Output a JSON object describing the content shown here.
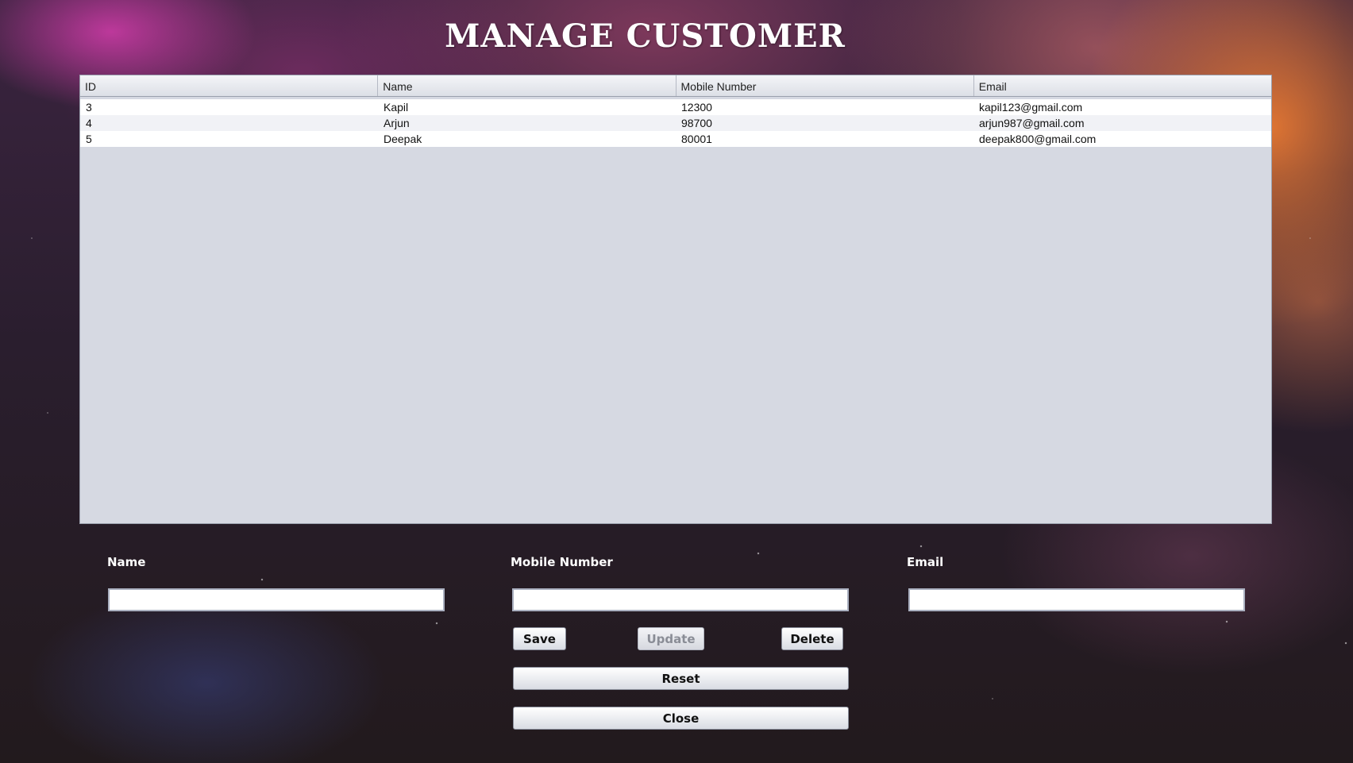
{
  "title": "Manage Customer",
  "table": {
    "columns": [
      "ID",
      "Name",
      "Mobile Number",
      "Email"
    ],
    "rows": [
      [
        "3",
        "Kapil",
        "12300",
        "kapil123@gmail.com"
      ],
      [
        "4",
        "Arjun",
        "98700",
        "arjun987@gmail.com"
      ],
      [
        "5",
        "Deepak",
        "80001",
        "deepak800@gmail.com"
      ]
    ]
  },
  "form": {
    "name_label": "Name",
    "mobile_label": "Mobile Number",
    "email_label": "Email",
    "name_value": "",
    "mobile_value": "",
    "email_value": ""
  },
  "buttons": {
    "save": "Save",
    "update": "Update",
    "delete": "Delete",
    "reset": "Reset",
    "close": "Close"
  },
  "states": {
    "update_enabled": false
  }
}
